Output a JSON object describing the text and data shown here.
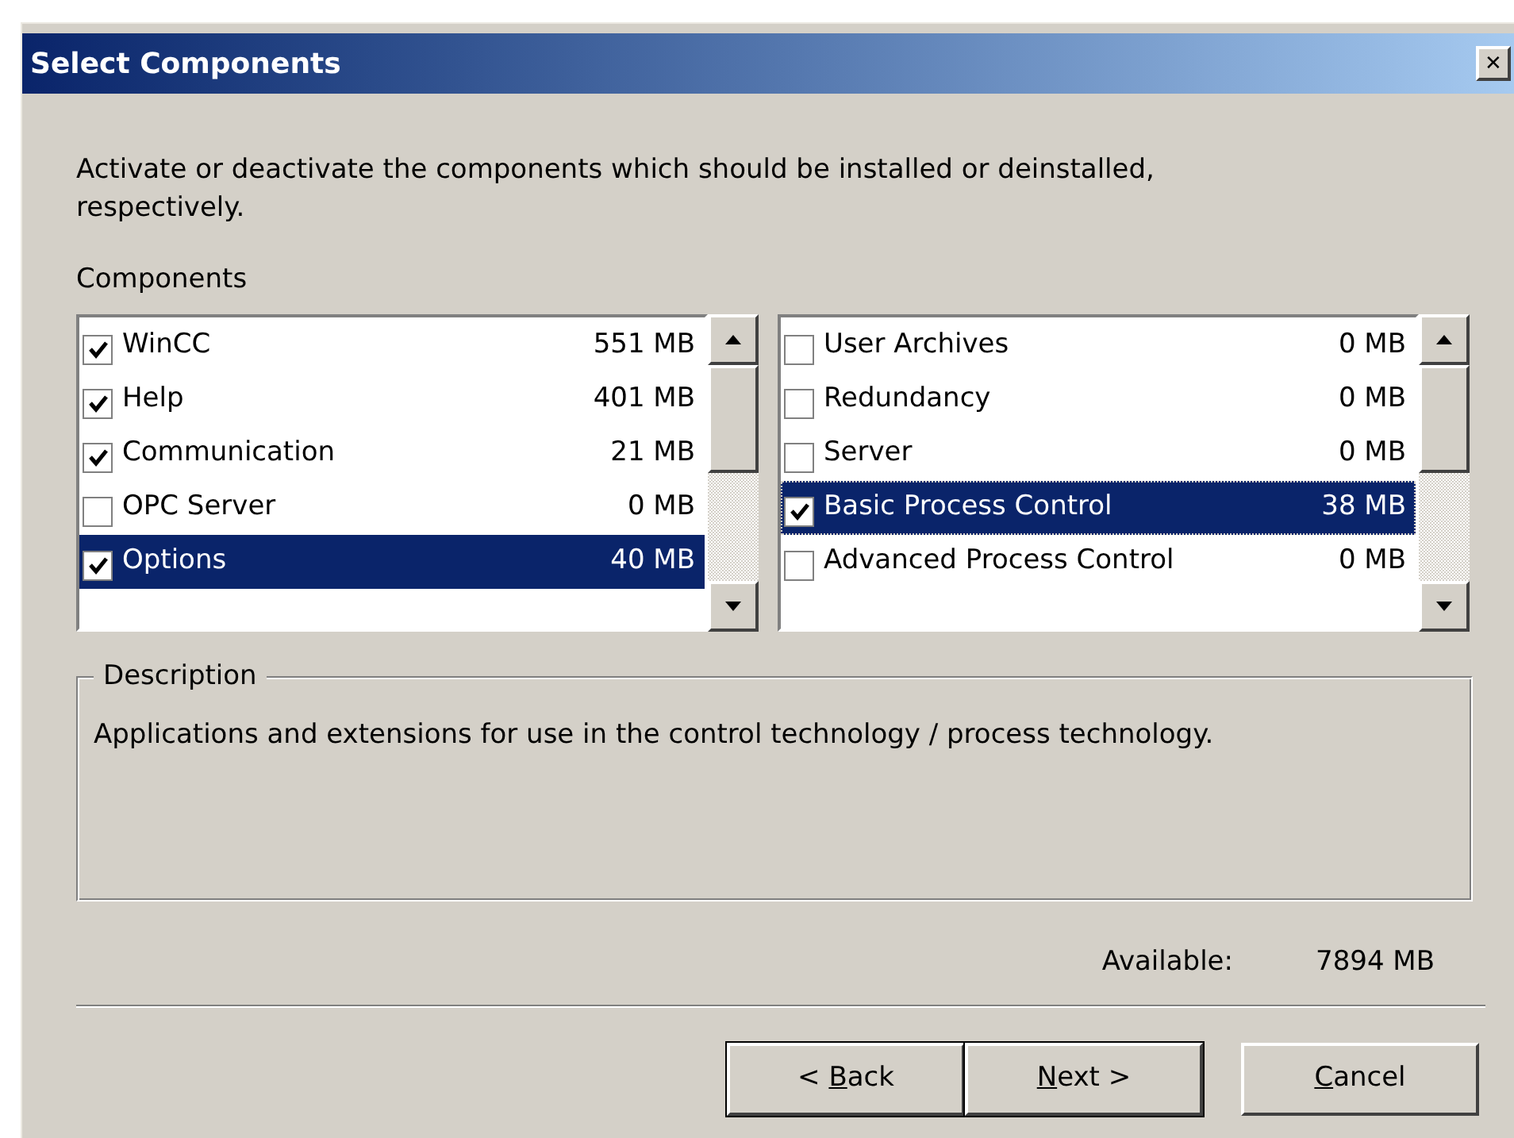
{
  "window": {
    "title": "Select Components",
    "close": "✕"
  },
  "instruction": "Activate or deactivate the components which should be installed or deinstalled, respectively.",
  "components_label": "Components",
  "lists": [
    {
      "items": [
        {
          "name": "WinCC",
          "size": "551 MB",
          "checked": true,
          "selected": false,
          "focused": false
        },
        {
          "name": "Help",
          "size": "401 MB",
          "checked": true,
          "selected": false,
          "focused": false
        },
        {
          "name": "Communication",
          "size": "21 MB",
          "checked": true,
          "selected": false,
          "focused": false
        },
        {
          "name": "OPC Server",
          "size": "0 MB",
          "checked": false,
          "selected": false,
          "focused": false
        },
        {
          "name": "Options",
          "size": "40 MB",
          "checked": true,
          "selected": true,
          "focused": false
        }
      ]
    },
    {
      "items": [
        {
          "name": "User Archives",
          "size": "0 MB",
          "checked": false,
          "selected": false,
          "focused": false
        },
        {
          "name": "Redundancy",
          "size": "0 MB",
          "checked": false,
          "selected": false,
          "focused": false
        },
        {
          "name": "Server",
          "size": "0 MB",
          "checked": false,
          "selected": false,
          "focused": false
        },
        {
          "name": "Basic Process Control",
          "size": "38 MB",
          "checked": true,
          "selected": true,
          "focused": true
        },
        {
          "name": "Advanced Process Control",
          "size": "0 MB",
          "checked": false,
          "selected": false,
          "focused": false
        }
      ]
    }
  ],
  "description": {
    "legend": "Description",
    "text": "Applications and extensions for use in the control technology / process technology."
  },
  "available": {
    "label": "Available:",
    "value": "7894 MB"
  },
  "buttons": [
    {
      "before": "< ",
      "key": "B",
      "after": "ack"
    },
    {
      "key": "N",
      "after": "ext >"
    },
    {
      "key": "C",
      "after": "ancel"
    }
  ]
}
